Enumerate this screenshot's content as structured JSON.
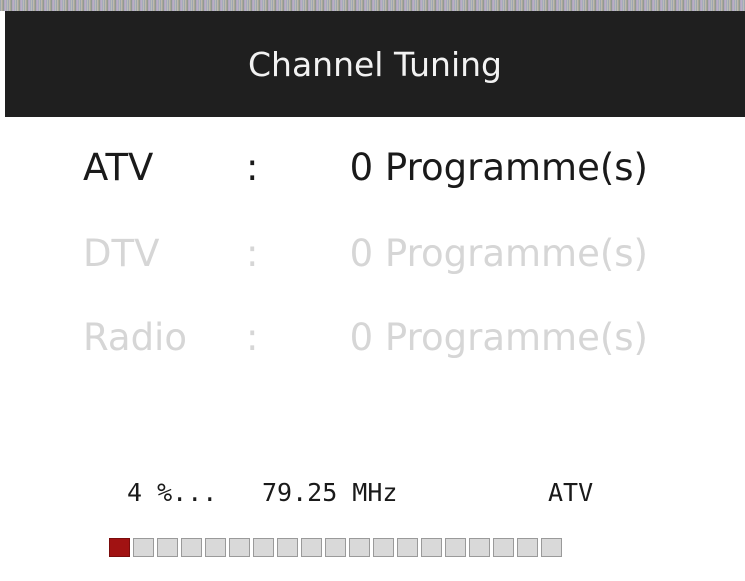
{
  "header": {
    "title": "Channel Tuning"
  },
  "rows": [
    {
      "name": "ATV",
      "separator": ":",
      "count": "0 Programme(s)",
      "state": "active"
    },
    {
      "name": "DTV",
      "separator": ":",
      "count": "0 Programme(s)",
      "state": "inactive"
    },
    {
      "name": "Radio",
      "separator": ":",
      "count": "0 Programme(s)",
      "state": "inactive"
    }
  ],
  "status": {
    "percent_text": "4  %...",
    "frequency": "79.25 MHz",
    "mode": "ATV"
  },
  "progress": {
    "segments_total": 19,
    "segments_filled": 1,
    "percent": 4
  },
  "colors": {
    "header_bg": "#1f1f1f",
    "header_text": "#f2f2f2",
    "active_text": "#1a1a1a",
    "inactive_text": "#d6d6d6",
    "progress_fill": "#a11212",
    "progress_empty": "#d9d9d9"
  }
}
